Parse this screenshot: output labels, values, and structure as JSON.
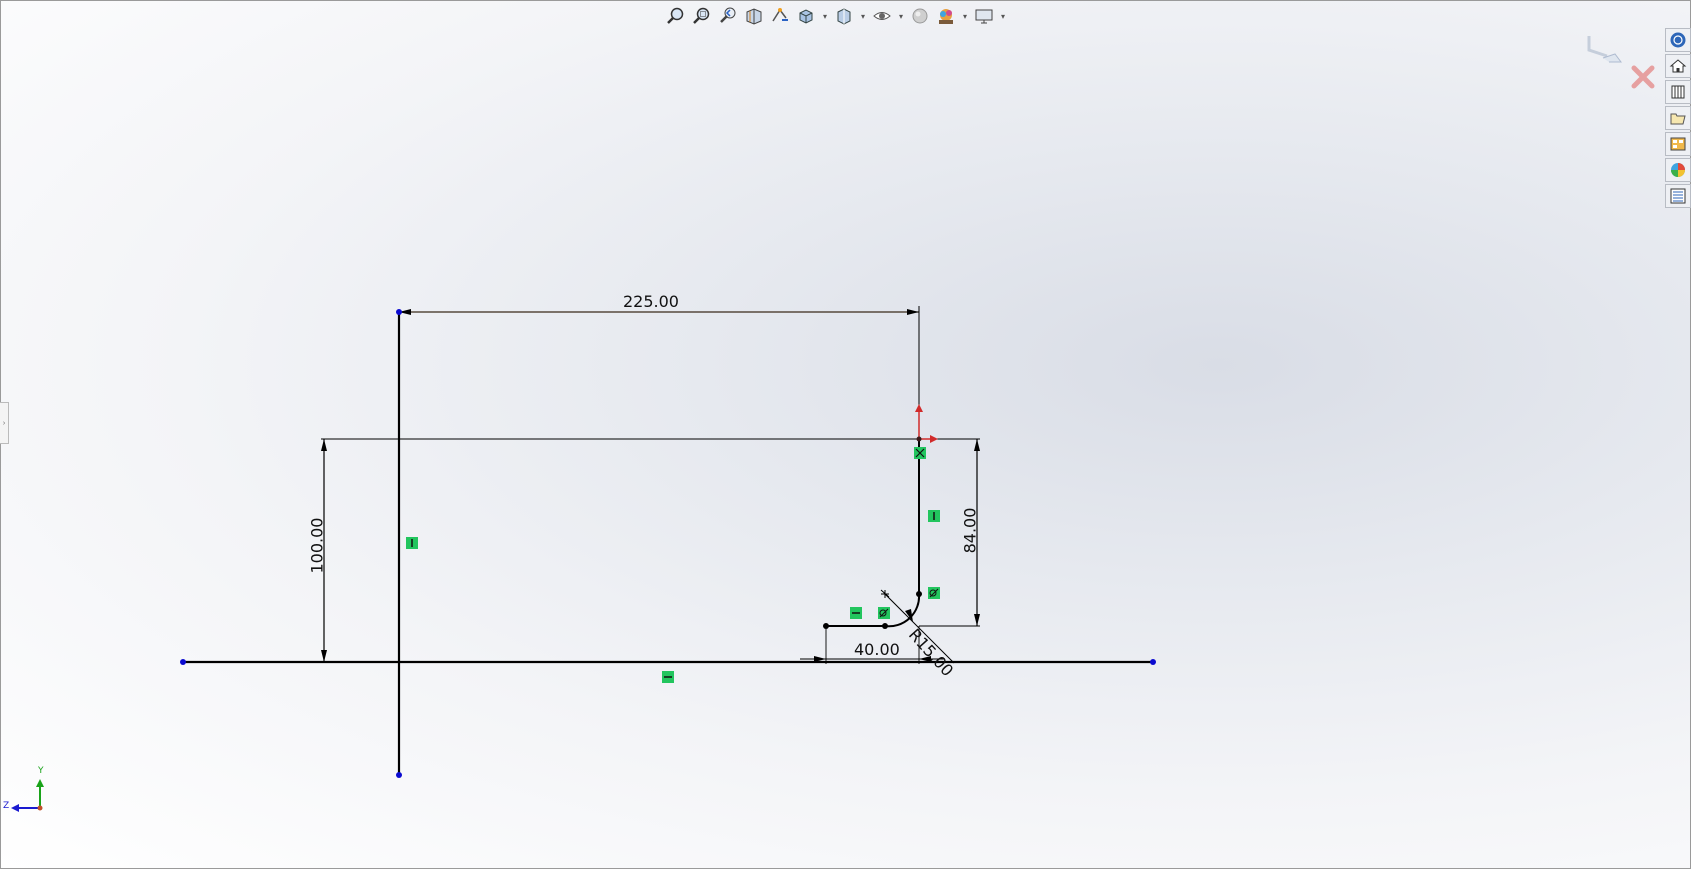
{
  "toolbar": {
    "items": [
      {
        "name": "zoom-to-fit-icon"
      },
      {
        "name": "zoom-to-area-icon"
      },
      {
        "name": "previous-view-icon"
      },
      {
        "name": "section-view-icon"
      },
      {
        "name": "dynamic-annotation-icon"
      },
      {
        "name": "view-orientation-icon",
        "dropdown": true
      },
      {
        "name": "display-style-icon",
        "dropdown": true
      },
      {
        "name": "hide-show-items-icon",
        "dropdown": true
      },
      {
        "name": "edit-appearance-icon"
      },
      {
        "name": "apply-scene-icon",
        "dropdown": true
      },
      {
        "name": "view-settings-icon",
        "dropdown": true
      }
    ]
  },
  "task_pane": {
    "items": [
      {
        "name": "solidworks-resources-icon"
      },
      {
        "name": "home-icon"
      },
      {
        "name": "design-library-icon"
      },
      {
        "name": "file-explorer-icon"
      },
      {
        "name": "view-palette-icon"
      },
      {
        "name": "appearances-icon"
      },
      {
        "name": "custom-properties-icon"
      }
    ]
  },
  "sketch": {
    "dimensions": {
      "width_225": "225.00",
      "height_100": "100.00",
      "height_84": "84.00",
      "offset_40": "40.00",
      "radius": "R15.00"
    },
    "colors": {
      "sketch_line": "#000000",
      "endpoint": "#0a0ad0",
      "relation": "#22c55e",
      "origin_x": "#d12b2b",
      "origin_y": "#d12b2b"
    }
  },
  "triad": {
    "y_label": "Y",
    "z_label": "Z",
    "y_color": "#1aa31a",
    "z_color": "#1a1ad0"
  },
  "confirm_corner": {
    "accept_icon": "ok-checkmark-icon",
    "cancel_icon": "cancel-x-icon"
  }
}
